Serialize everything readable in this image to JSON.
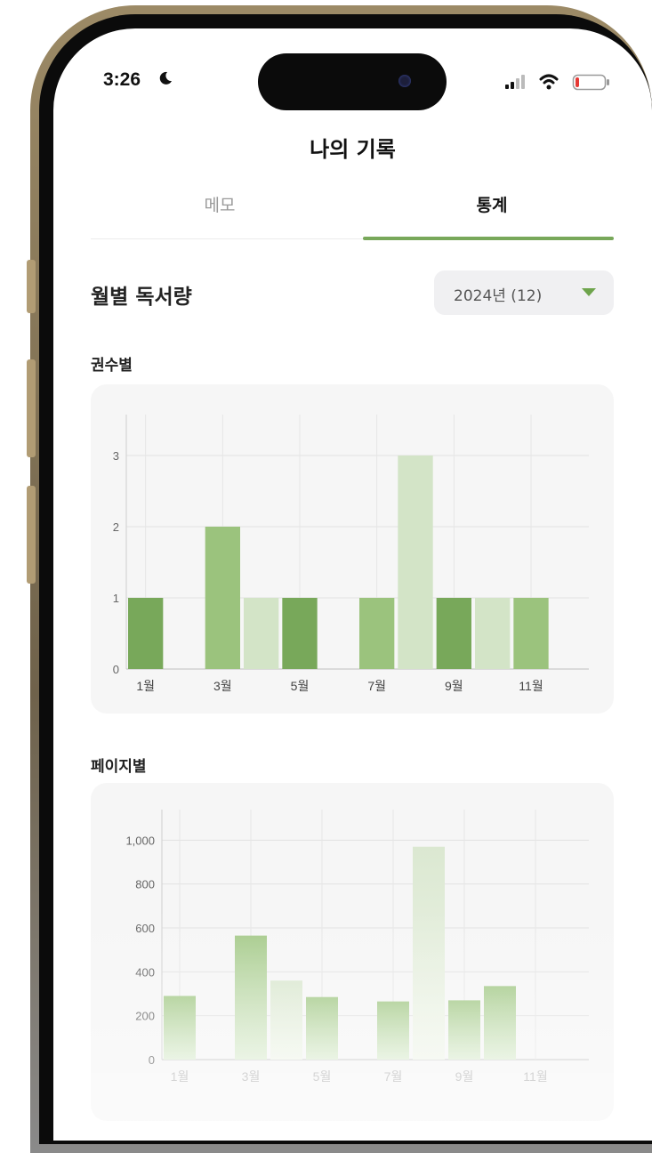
{
  "status_bar": {
    "time": "3:26"
  },
  "header": {
    "title": "나의 기록"
  },
  "tabs": [
    {
      "label": "메모",
      "active": false
    },
    {
      "label": "통계",
      "active": true
    }
  ],
  "section": {
    "title": "월별 독서량",
    "year_select": {
      "value": "2024년 (12)"
    }
  },
  "colors": {
    "accent": "#78a85a",
    "bar_dark": "#78a85a",
    "bar_mid": "#9bc37d",
    "bar_light": "#d3e4c7"
  },
  "charts": {
    "books": {
      "subtitle": "권수별"
    },
    "pages": {
      "subtitle": "페이지별"
    }
  },
  "chart_data": [
    {
      "type": "bar",
      "categories": [
        "1월",
        "2월",
        "3월",
        "4월",
        "5월",
        "6월",
        "7월",
        "8월",
        "9월",
        "10월",
        "11월",
        "12월"
      ],
      "x_tick_labels": [
        "1월",
        "3월",
        "5월",
        "7월",
        "9월",
        "11월"
      ],
      "values": [
        1,
        0,
        2,
        1,
        1,
        0,
        1,
        3,
        1,
        1,
        1,
        0
      ],
      "shades": [
        "dark",
        "dark",
        "mid",
        "light",
        "dark",
        "dark",
        "mid",
        "light",
        "dark",
        "light",
        "mid",
        "mid"
      ],
      "ylim": [
        0,
        3.3
      ],
      "y_ticks": [
        0,
        1,
        2,
        3
      ],
      "y_tick_labels": [
        "0",
        "1",
        "2",
        "3"
      ],
      "grid": true
    },
    {
      "type": "bar",
      "categories": [
        "1월",
        "2월",
        "3월",
        "4월",
        "5월",
        "6월",
        "7월",
        "8월",
        "9월",
        "10월",
        "11월",
        "12월"
      ],
      "x_tick_labels": [
        "1월",
        "3월",
        "5월",
        "7월",
        "9월",
        "11월"
      ],
      "values": [
        290,
        0,
        565,
        360,
        285,
        0,
        265,
        970,
        270,
        335,
        0,
        0
      ],
      "shades": [
        "mid",
        "mid",
        "mid",
        "light",
        "mid",
        "mid",
        "mid",
        "light",
        "mid",
        "mid",
        "mid",
        "mid"
      ],
      "ylim": [
        0,
        1050
      ],
      "y_ticks": [
        0,
        200,
        400,
        600,
        800,
        1000
      ],
      "y_tick_labels": [
        "0",
        "200",
        "400",
        "600",
        "800",
        "1,000"
      ],
      "grid": true
    }
  ]
}
